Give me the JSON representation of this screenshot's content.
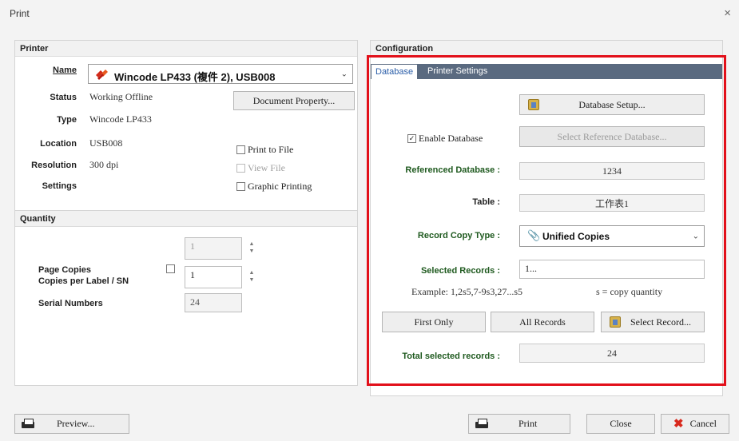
{
  "window": {
    "title": "Print",
    "close_glyph": "×"
  },
  "printer": {
    "header": "Printer",
    "name_label": "Name",
    "name_value": "Wincode LP433 (複件 2), USB008",
    "status_label": "Status",
    "status_value": "Working Offline",
    "type_label": "Type",
    "type_value": "Wincode LP433",
    "location_label": "Location",
    "location_value": "USB008",
    "resolution_label": "Resolution",
    "resolution_value": "300 dpi",
    "settings_label": "Settings",
    "document_property_button": "Document Property...",
    "print_to_file": "Print to File",
    "view_file": "View File",
    "graphic_printing": "Graphic Printing"
  },
  "quantity": {
    "header": "Quantity",
    "page_copies_label": "Page Copies",
    "page_copies_value": "1",
    "copies_per_label_label": "Copies per Label / SN",
    "copies_per_label_value": "1",
    "serial_numbers_label": "Serial Numbers",
    "serial_numbers_value": "24"
  },
  "configuration": {
    "header": "Configuration",
    "tabs": [
      {
        "label": "Database",
        "active": true
      },
      {
        "label": "Printer Settings",
        "active": false
      }
    ],
    "database_setup_button": "Database Setup...",
    "enable_database_label": "Enable Database",
    "enable_database_checked": true,
    "select_reference_db_button": "Select Reference Database...",
    "referenced_database_label": "Referenced Database :",
    "referenced_database_value": "1234",
    "table_label": "Table :",
    "table_value": "工作表1",
    "record_copy_type_label": "Record Copy Type :",
    "record_copy_type_value": "Unified Copies",
    "selected_records_label": "Selected Records :",
    "selected_records_value": "1...",
    "example_text": "Example: 1,2s5,7-9s3,27...s5",
    "copy_quantity_hint": "s = copy quantity",
    "first_only_button": "First Only",
    "all_records_button": "All Records",
    "select_record_button": "Select Record...",
    "total_selected_label": "Total selected records :",
    "total_selected_value": "24"
  },
  "footer": {
    "preview_button": "Preview...",
    "print_button": "Print",
    "close_button": "Close",
    "cancel_button": "Cancel"
  },
  "colors": {
    "highlight_border": "#e2101a",
    "tab_strip": "#5a6a80",
    "label_green": "#1f5a1f"
  },
  "icons": [
    "close-icon",
    "printer-brand-icon",
    "chevron-down-icon",
    "database-icon",
    "checkmark-icon",
    "paperclip-icon",
    "printer-icon",
    "cancel-x-icon"
  ]
}
